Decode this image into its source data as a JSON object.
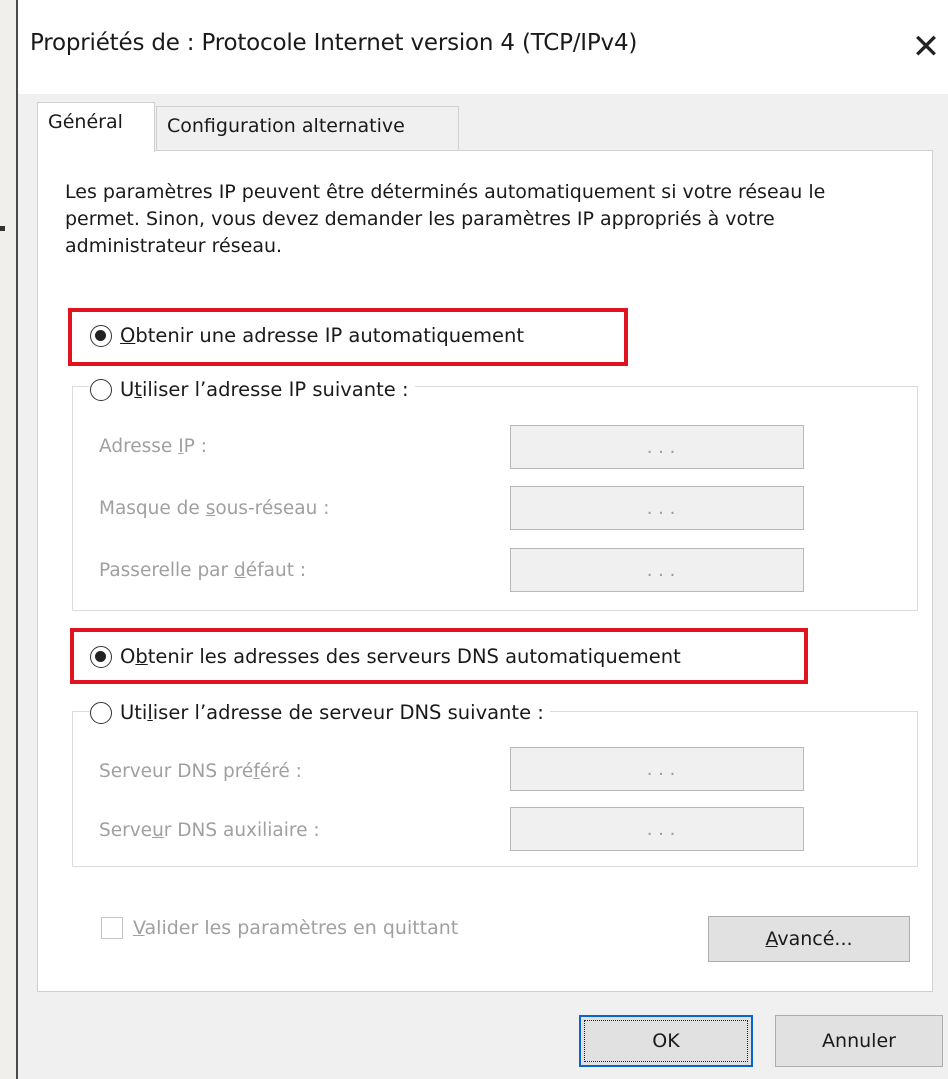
{
  "window": {
    "title": "Propriétés de : Protocole Internet version 4 (TCP/IPv4)",
    "close_icon": "close-icon"
  },
  "tabs": [
    {
      "label": "Général",
      "active": true
    },
    {
      "label": "Configuration alternative",
      "active": false
    }
  ],
  "description": "Les paramètres IP peuvent être déterminés automatiquement si votre réseau le permet. Sinon, vous devez demander les paramètres IP appropriés à votre administrateur réseau.",
  "ip": {
    "auto": {
      "label_pre": "",
      "accel": "O",
      "label_post": "btenir une adresse IP automatiquement",
      "checked": true
    },
    "manual": {
      "label_pre": "U",
      "accel": "t",
      "label_post": "iliser l’adresse IP suivante :",
      "checked": false
    },
    "fields": [
      {
        "pre": "Adresse ",
        "accel": "I",
        "post": "P :",
        "value": ". . ."
      },
      {
        "pre": "Masque de ",
        "accel": "s",
        "post": "ous-réseau :",
        "value": ". . ."
      },
      {
        "pre": "Passerelle par ",
        "accel": "d",
        "post": "éfaut :",
        "value": ". . ."
      }
    ]
  },
  "dns": {
    "auto": {
      "label_pre": "O",
      "accel": "b",
      "label_post": "tenir les adresses des serveurs DNS automatiquement",
      "checked": true
    },
    "manual": {
      "label_pre": "Uti",
      "accel": "l",
      "label_post": "iser l’adresse de serveur DNS suivante :",
      "checked": false
    },
    "fields": [
      {
        "pre": "Serveur DNS pré",
        "accel": "f",
        "post": "éré :",
        "value": ". . ."
      },
      {
        "pre": "Serve",
        "accel": "u",
        "post": "r DNS auxiliaire :",
        "value": ". . ."
      }
    ]
  },
  "validate": {
    "accel": "V",
    "post": "alider les paramètres en quittant",
    "checked": false
  },
  "buttons": {
    "advanced_accel": "A",
    "advanced_post": "vancé...",
    "ok": "OK",
    "cancel": "Annuler"
  },
  "colors": {
    "highlight": "#e0141e",
    "ok_focus": "#0a64d0"
  }
}
